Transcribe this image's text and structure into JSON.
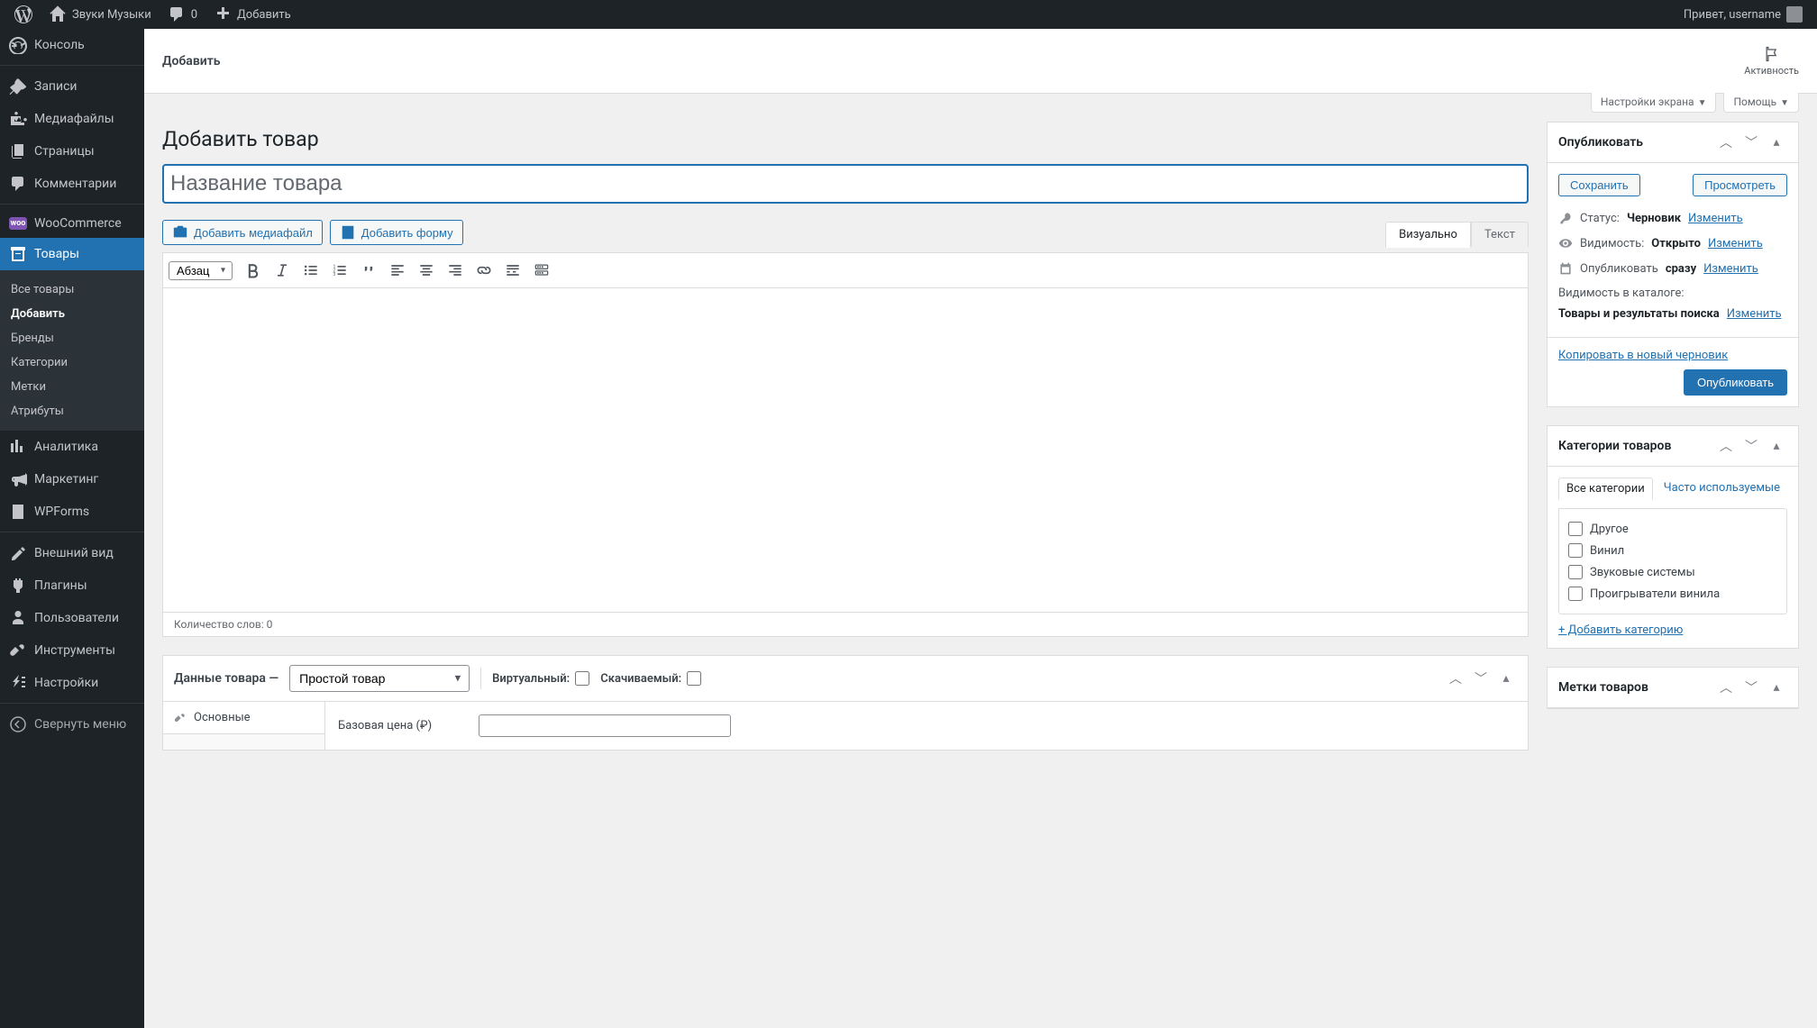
{
  "adminbar": {
    "site_name": "Звуки Музыки",
    "comments_count": "0",
    "add_new": "Добавить",
    "greeting": "Привет, username"
  },
  "sidebar": {
    "dashboard": "Консоль",
    "posts": "Записи",
    "media": "Медиафайлы",
    "pages": "Страницы",
    "comments": "Комментарии",
    "woocommerce": "WooCommerce",
    "products": "Товары",
    "analytics": "Аналитика",
    "marketing": "Маркетинг",
    "wpforms": "WPForms",
    "appearance": "Внешний вид",
    "plugins": "Плагины",
    "users": "Пользователи",
    "tools": "Инструменты",
    "settings": "Настройки",
    "collapse": "Свернуть меню",
    "submenu": {
      "all": "Все товары",
      "add": "Добавить",
      "brands": "Бренды",
      "categories": "Категории",
      "tags": "Метки",
      "attributes": "Атрибуты"
    }
  },
  "topbar": {
    "title": "Добавить",
    "activity": "Активность"
  },
  "screen": {
    "options": "Настройки экрана",
    "help": "Помощь"
  },
  "page": {
    "heading": "Добавить товар",
    "title_placeholder": "Название товара"
  },
  "media_buttons": {
    "add_media": "Добавить медиафайл",
    "add_form": "Добавить форму"
  },
  "editor": {
    "tab_visual": "Визуально",
    "tab_text": "Текст",
    "format": "Абзац",
    "word_count": "Количество слов: 0"
  },
  "publish": {
    "title": "Опубликовать",
    "save": "Сохранить",
    "preview": "Просмотреть",
    "status_label": "Статус:",
    "status_value": "Черновик",
    "visibility_label": "Видимость:",
    "visibility_value": "Открыто",
    "publish_label": "Опубликовать",
    "publish_value": "сразу",
    "catalog_label": "Видимость в каталоге:",
    "catalog_value": "Товары и результаты поиска",
    "change": "Изменить",
    "copy_draft": "Копировать в новый черновик",
    "publish_btn": "Опубликовать"
  },
  "categories": {
    "title": "Категории товаров",
    "tab_all": "Все категории",
    "tab_popular": "Часто используемые",
    "items": [
      "Другое",
      "Винил",
      "Звуковые системы",
      "Проигрыватели винила"
    ],
    "add": "+ Добавить категорию"
  },
  "tags": {
    "title": "Метки товаров"
  },
  "product_data": {
    "title": "Данные товара —",
    "type": "Простой товар",
    "virtual": "Виртуальный:",
    "downloadable": "Скачиваемый:",
    "tab_general": "Основные",
    "base_price": "Базовая цена (₽)"
  }
}
